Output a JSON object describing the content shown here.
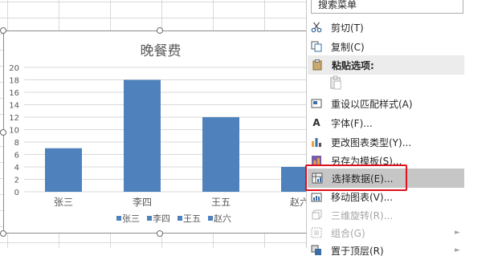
{
  "chart": {
    "title": "晚餐费",
    "legend": [
      "张三",
      "李四",
      "王五",
      "赵六"
    ],
    "bar_color": "#4f81bd"
  },
  "chart_data": {
    "type": "bar",
    "title": "晚餐费",
    "categories": [
      "张三",
      "李四",
      "王五",
      "赵六"
    ],
    "values": [
      7,
      18,
      12,
      4
    ],
    "ylim": [
      0,
      20
    ],
    "yticks": [
      0,
      2,
      4,
      6,
      8,
      10,
      12,
      14,
      16,
      18,
      20
    ],
    "legend_position": "bottom",
    "grid": true
  },
  "menu": {
    "search_placeholder": "搜索菜单",
    "items": [
      {
        "label": "剪切(T)",
        "icon": "scissors-icon",
        "disabled": false
      },
      {
        "label": "复制(C)",
        "icon": "copy-icon",
        "disabled": false
      },
      {
        "label": "粘贴选项:",
        "icon": "paste-icon",
        "section": true
      },
      {
        "label": "",
        "icon": "clipboard-icon",
        "disabled": true
      },
      {
        "label": "重设以匹配样式(A)",
        "icon": "reset-style-icon",
        "disabled": false
      },
      {
        "label": "字体(F)...",
        "icon": "font-icon",
        "disabled": false
      },
      {
        "label": "更改图表类型(Y)...",
        "icon": "chart-type-icon",
        "disabled": false
      },
      {
        "label": "另存为模板(S)...",
        "icon": "save-template-icon",
        "disabled": false
      },
      {
        "label": "选择数据(E)...",
        "icon": "select-data-icon",
        "disabled": false,
        "highlighted": true
      },
      {
        "label": "移动图表(V)...",
        "icon": "move-chart-icon",
        "disabled": false
      },
      {
        "label": "三维旋转(R)...",
        "icon": "rotate-3d-icon",
        "disabled": true
      },
      {
        "label": "组合(G)",
        "icon": "group-icon",
        "disabled": true,
        "submenu": true
      },
      {
        "label": "置于顶层(R)",
        "icon": "bring-front-icon",
        "disabled": false,
        "submenu": true
      }
    ]
  }
}
